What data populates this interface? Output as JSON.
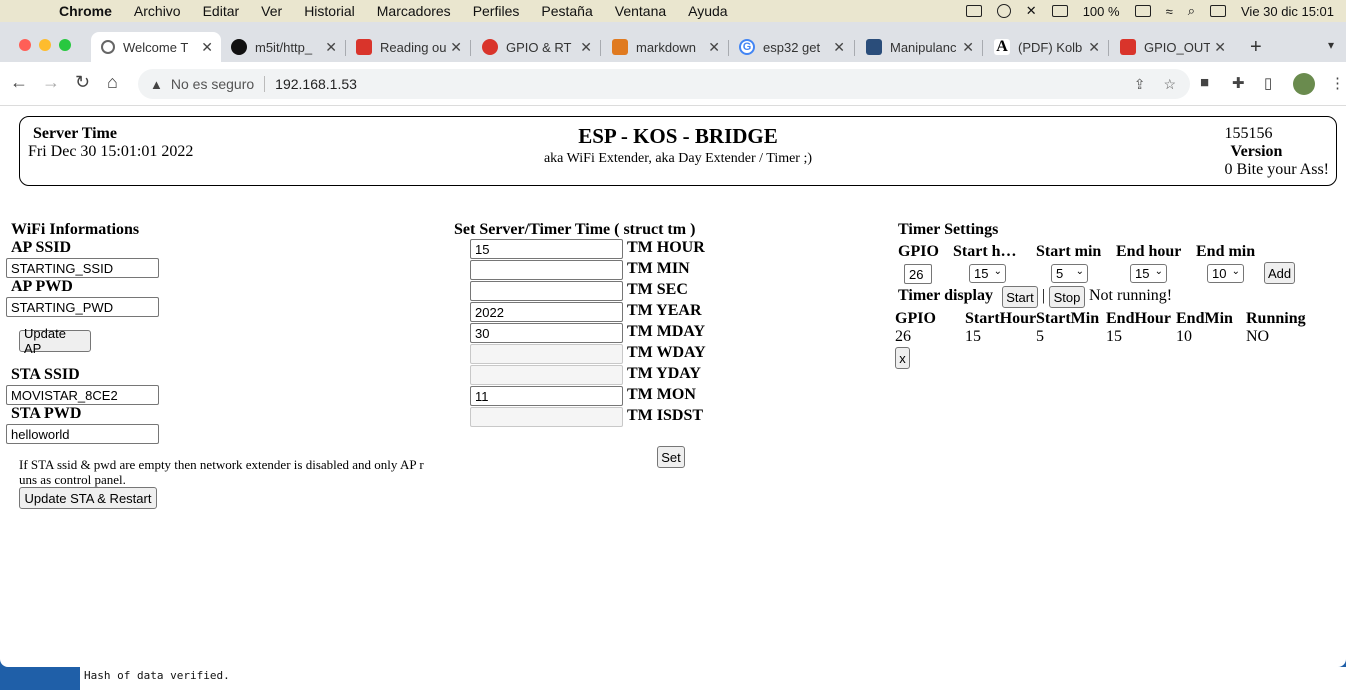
{
  "menubar": {
    "app": "Chrome",
    "items": [
      "Archivo",
      "Editar",
      "Ver",
      "Historial",
      "Marcadores",
      "Perfiles",
      "Pestaña",
      "Ventana",
      "Ayuda"
    ],
    "battery": "100 %",
    "clock": "Vie 30 dic  15:01"
  },
  "tabs": [
    {
      "label": "Welcome T",
      "color": "#555"
    },
    {
      "label": "m5it/http_",
      "color": "#111"
    },
    {
      "label": "Reading ou",
      "color": "#d9342b"
    },
    {
      "label": "GPIO & RT",
      "color": "#d9342b"
    },
    {
      "label": "markdown",
      "color": "#e07a1f"
    },
    {
      "label": "esp32 get",
      "color": "#4285f4"
    },
    {
      "label": "Manipulanc",
      "color": "#2a4d7a"
    },
    {
      "label": "(PDF) Kolb",
      "color": "#000"
    },
    {
      "label": "GPIO_OUT",
      "color": "#d9342b"
    }
  ],
  "toolbar": {
    "security": "No es seguro",
    "url": "192.168.1.53"
  },
  "header": {
    "server_time_label": "Server Time",
    "server_time": "Fri Dec 30 15:01:01 2022",
    "title": "ESP - KOS - BRIDGE",
    "subtitle": "aka WiFi Extender, aka Day Extender / Timer ;)",
    "build": "155156",
    "version_label": "Version",
    "version_text": "0 Bite your Ass!"
  },
  "wifi": {
    "section_title": "WiFi Informations",
    "ap_ssid_label": "AP SSID",
    "ap_ssid": "STARTING_SSID",
    "ap_pwd_label": "AP PWD",
    "ap_pwd": "STARTING_PWD",
    "update_ap": "Update AP",
    "sta_ssid_label": "STA SSID",
    "sta_ssid": "MOVISTAR_8CE2",
    "sta_pwd_label": "STA PWD",
    "sta_pwd": "helloworld",
    "note": "If STA ssid & pwd are empty then network extender is disabled and only AP r uns as control panel.",
    "update_sta": "Update STA & Restart"
  },
  "server_time_form": {
    "title": "Set Server/Timer Time ( struct tm )",
    "fields": [
      {
        "label": "TM HOUR",
        "value": "15"
      },
      {
        "label": "TM MIN",
        "value": ""
      },
      {
        "label": "TM SEC",
        "value": ""
      },
      {
        "label": "TM YEAR",
        "value": "2022"
      },
      {
        "label": "TM MDAY",
        "value": "30"
      },
      {
        "label": "TM WDAY",
        "value": ""
      },
      {
        "label": "TM YDAY",
        "value": ""
      },
      {
        "label": "TM MON",
        "value": "11"
      },
      {
        "label": "TM ISDST",
        "value": ""
      }
    ],
    "set_button": "Set"
  },
  "timer": {
    "title": "Timer Settings",
    "headers": [
      "GPIO",
      "Start h…",
      "Start min",
      "End hour",
      "End min"
    ],
    "gpio": "26",
    "start_hour": "15",
    "start_min": "5",
    "end_hour": "15",
    "end_min": "10",
    "add_button": "Add",
    "display_label": "Timer display",
    "start_button": "Start",
    "separator": "|",
    "stop_button": "Stop",
    "status": "Not running!",
    "table_headers": [
      "GPIO",
      "StartHour",
      "StartMin",
      "EndHour",
      "EndMin",
      "Running"
    ],
    "table_row": [
      "26",
      "15",
      "5",
      "15",
      "10",
      "NO"
    ],
    "remove_button": "x"
  },
  "terminal": {
    "line": "Hash of data verified."
  }
}
